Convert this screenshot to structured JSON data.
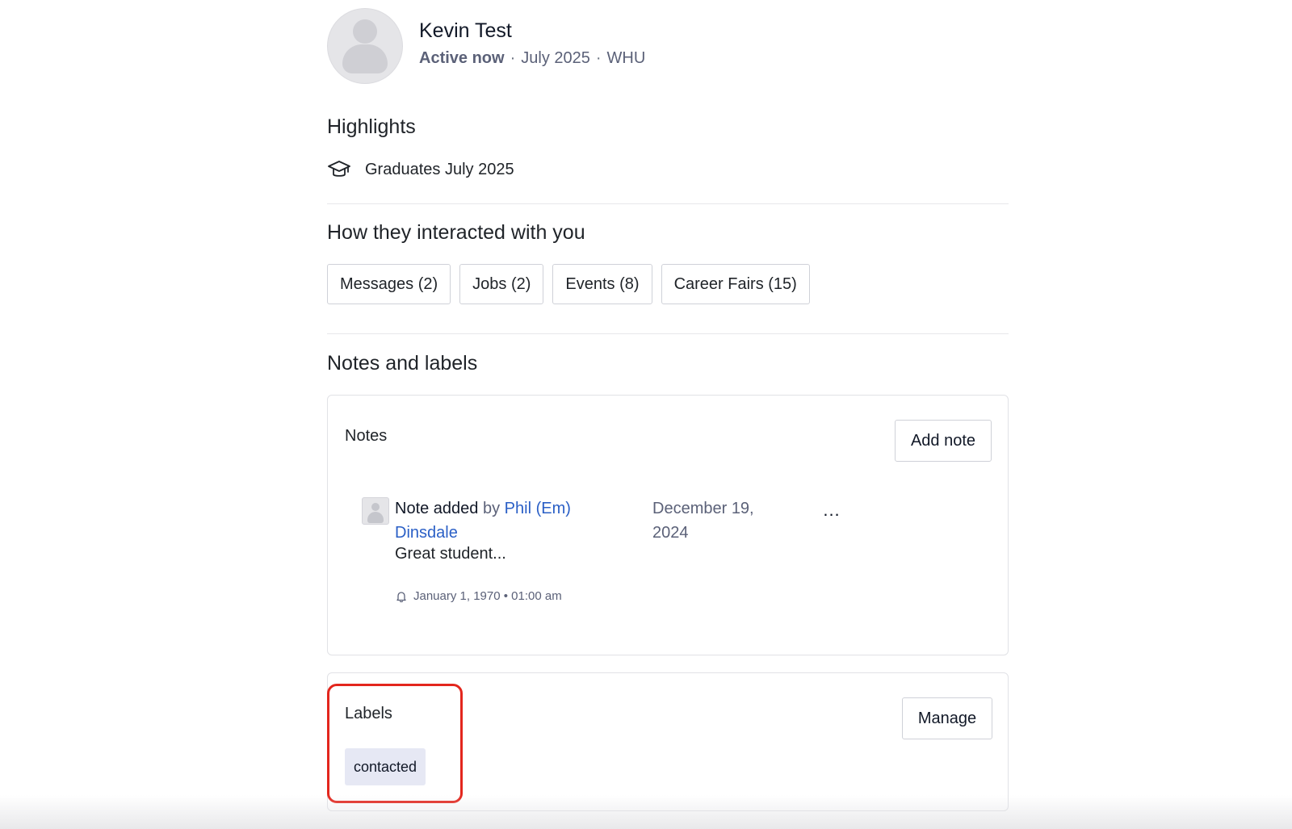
{
  "profile": {
    "name": "Kevin Test",
    "status": "Active now",
    "graduation": "July 2025",
    "school": "WHU",
    "separator": "·"
  },
  "highlights": {
    "title": "Highlights",
    "items": [
      {
        "icon": "graduation-cap-icon",
        "text": "Graduates July 2025"
      }
    ]
  },
  "interactions": {
    "title": "How they interacted with you",
    "chips": [
      {
        "label": "Messages (2)"
      },
      {
        "label": "Jobs (2)"
      },
      {
        "label": "Events (8)"
      },
      {
        "label": "Career Fairs (15)"
      }
    ]
  },
  "notes_labels": {
    "title": "Notes and labels",
    "notes": {
      "title": "Notes",
      "add_button": "Add note",
      "items": [
        {
          "action": "Note added",
          "by": "by",
          "author": "Phil (Em) Dinsdale",
          "date": "December 19, 2024",
          "menu": "...",
          "body": "Great student...",
          "reminder": "January 1, 1970 • 01:00 am"
        }
      ]
    },
    "labels": {
      "title": "Labels",
      "manage_button": "Manage",
      "tags": [
        "contacted"
      ]
    }
  },
  "colors": {
    "link": "#2a5fc6",
    "muted": "#5b6178",
    "label_bg": "#e6e8f4",
    "highlight_outline": "#e3261d"
  }
}
